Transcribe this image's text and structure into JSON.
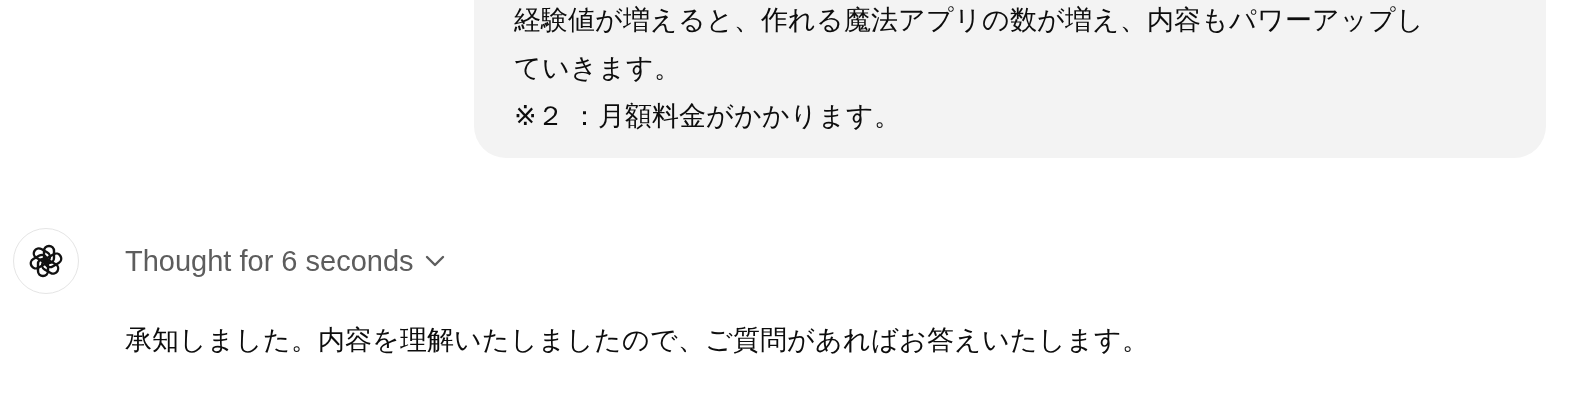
{
  "user_message": {
    "lines": [
      "経験値が増えると、作れる魔法アプリの数が増え、内容もパワーアップし",
      "ていきます。",
      "※２ ：月額料金がかかります。"
    ]
  },
  "assistant_message": {
    "thought": {
      "label": "Thought for 6 seconds",
      "expanded": false
    },
    "text": "承知しました。内容を理解いたしましたので、ご質問があればお答えいたします。"
  }
}
